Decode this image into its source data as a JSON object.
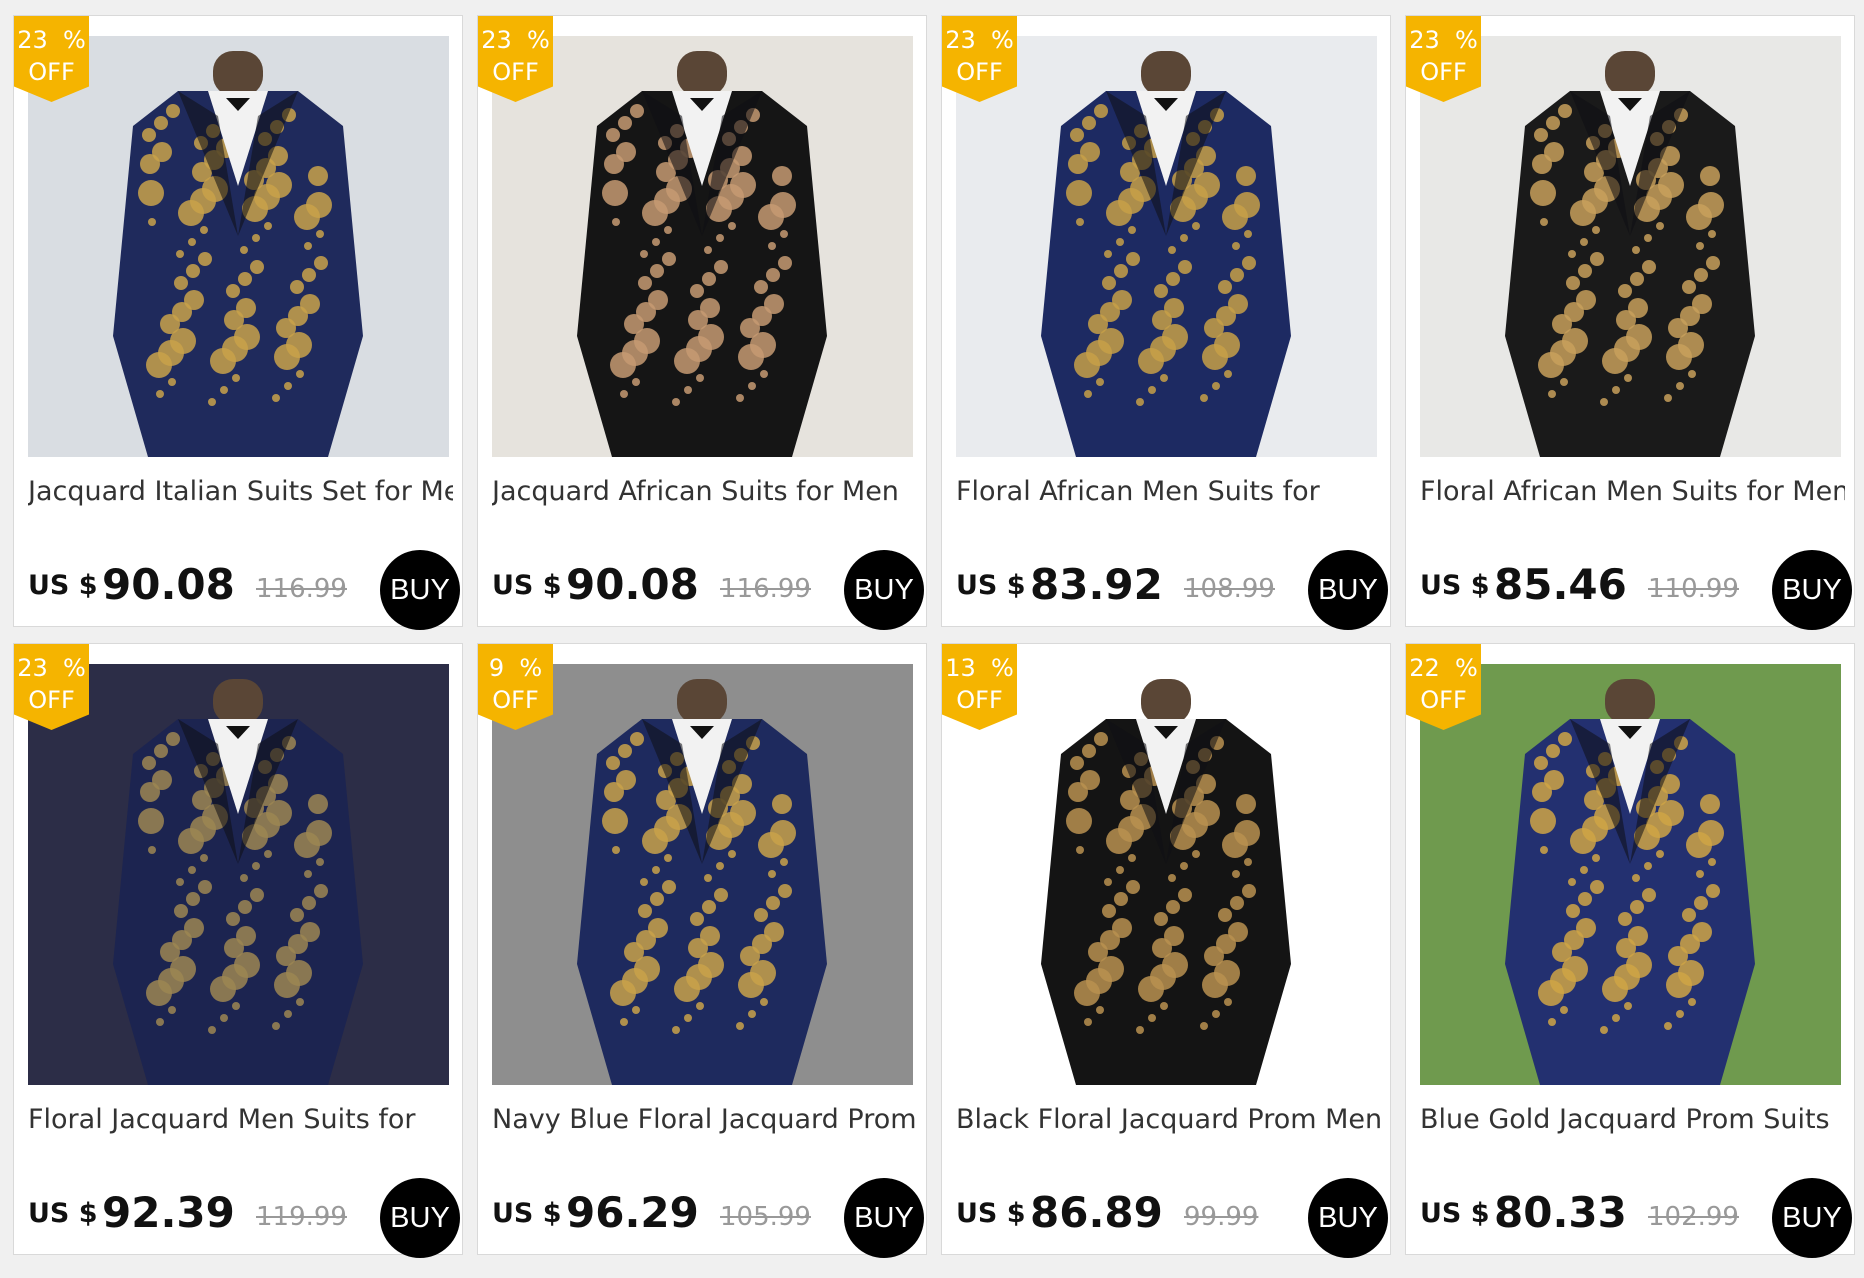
{
  "products": [
    {
      "title": "Jacquard Italian Suits Set for Men",
      "currency": "US $",
      "price": "90.08",
      "old_price": "116.99",
      "discount": "23  %",
      "off": "OFF",
      "buy": "BUY",
      "colors": {
        "bg": "#d9dde2",
        "suit": "#1f2a5c",
        "pattern": "#c9a24a"
      }
    },
    {
      "title": "Jacquard African Suits for Men",
      "currency": "US $",
      "price": "90.08",
      "old_price": "116.99",
      "discount": "23  %",
      "off": "OFF",
      "buy": "BUY",
      "colors": {
        "bg": "#e6e3dd",
        "suit": "#151515",
        "pattern": "#c59a72"
      }
    },
    {
      "title": "Floral African Men Suits for",
      "currency": "US $",
      "price": "83.92",
      "old_price": "108.99",
      "discount": "23  %",
      "off": "OFF",
      "buy": "BUY",
      "colors": {
        "bg": "#e9ebee",
        "suit": "#1d2a62",
        "pattern": "#c7a048"
      }
    },
    {
      "title": "Floral African Men Suits for Men",
      "currency": "US $",
      "price": "85.46",
      "old_price": "110.99",
      "discount": "23  %",
      "off": "OFF",
      "buy": "BUY",
      "colors": {
        "bg": "#e8e8e6",
        "suit": "#1a1a1a",
        "pattern": "#c8a05c"
      }
    },
    {
      "title": "Floral Jacquard Men Suits for",
      "currency": "US $",
      "price": "92.39",
      "old_price": "119.99",
      "discount": "23  %",
      "off": "OFF",
      "buy": "BUY",
      "colors": {
        "bg": "#2c2d47",
        "suit": "#1c2450",
        "pattern": "#9c8652"
      }
    },
    {
      "title": "Navy Blue Floral Jacquard Prom",
      "currency": "US $",
      "price": "96.29",
      "old_price": "105.99",
      "discount": "9  %",
      "off": "OFF",
      "buy": "BUY",
      "colors": {
        "bg": "#8e8e8e",
        "suit": "#1e2a5e",
        "pattern": "#c9a24a"
      }
    },
    {
      "title": "Black Floral Jacquard Prom Men",
      "currency": "US $",
      "price": "86.89",
      "old_price": "99.99",
      "discount": "13  %",
      "off": "OFF",
      "buy": "BUY",
      "colors": {
        "bg": "#ffffff",
        "suit": "#141414",
        "pattern": "#b89050"
      }
    },
    {
      "title": "Blue Gold Jacquard Prom Suits",
      "currency": "US $",
      "price": "80.33",
      "old_price": "102.99",
      "discount": "22  %",
      "off": "OFF",
      "buy": "BUY",
      "colors": {
        "bg": "#6f9a4e",
        "suit": "#233070",
        "pattern": "#cfa545"
      }
    }
  ]
}
